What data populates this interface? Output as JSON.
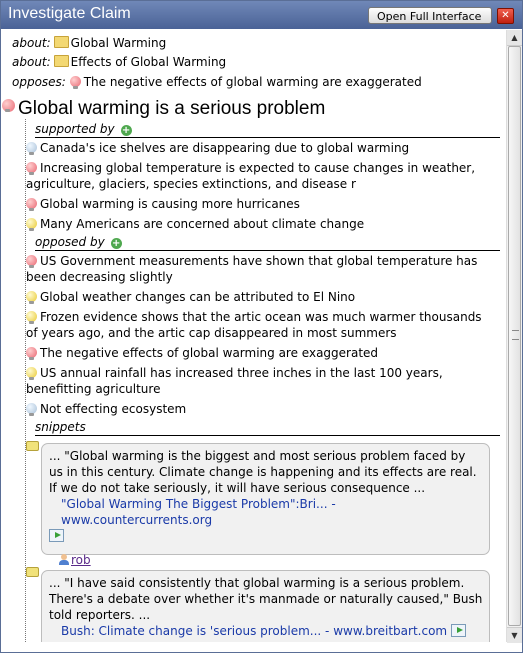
{
  "window": {
    "title": "Investigate Claim",
    "full_interface_label": "Open Full Interface",
    "close_label": "✕"
  },
  "relations": [
    {
      "label": "about:",
      "icon": "folder-icon",
      "text": "Global Warming"
    },
    {
      "label": "about:",
      "icon": "folder-icon",
      "text": "Effects of Global Warming"
    },
    {
      "label": "opposes:",
      "icon": "red-bulb-icon",
      "text": "The negative effects of global warming are exaggerated"
    }
  ],
  "claim": {
    "icon": "red-bulb-icon",
    "title": "Global warming is a serious problem"
  },
  "supported_by": {
    "label": "supported by",
    "items": [
      {
        "bulb": "blue",
        "text": "Canada's ice shelves are disappearing due to global warming"
      },
      {
        "bulb": "red",
        "text": "Increasing global temperature is expected to cause changes in weather, agriculture, glaciers, species extinctions, and disease r"
      },
      {
        "bulb": "red",
        "text": "Global warming is causing more hurricanes"
      },
      {
        "bulb": "yellow",
        "text": "Many Americans are concerned about climate change"
      }
    ]
  },
  "opposed_by": {
    "label": "opposed by",
    "items": [
      {
        "bulb": "red",
        "text": "US Government measurements have shown that global temperature has been decreasing slightly"
      },
      {
        "bulb": "yellow",
        "text": "Global weather changes can be attributed to El Nino"
      },
      {
        "bulb": "yellow",
        "text": "Frozen evidence shows that the artic ocean was much warmer thousands of years ago, and the artic cap disappeared in most summers"
      },
      {
        "bulb": "red",
        "text": "The negative effects of global warming are exaggerated"
      },
      {
        "bulb": "yellow",
        "text": "US annual rainfall has increased three inches in the last 100 years, benefitting agriculture"
      },
      {
        "bulb": "blue",
        "text": "Not effecting ecosystem"
      }
    ]
  },
  "snippets": {
    "label": "snippets",
    "items": [
      {
        "quote": "... \"Global warming is the biggest and most serious problem faced by us in this century. Climate change is happening and its effects are real. If we do not take seriously, it will have serious consequence ...",
        "link": "\"Global Warming The Biggest Problem\":Bri... - www.countercurrents.org",
        "user": "rob"
      },
      {
        "quote": "... \"I have said consistently that global warming is a serious problem. There's a debate over whether it's manmade or naturally caused,\" Bush told reporters. ...",
        "link": "Bush: Climate change is 'serious problem... - www.breitbart.com",
        "user": ""
      }
    ]
  }
}
